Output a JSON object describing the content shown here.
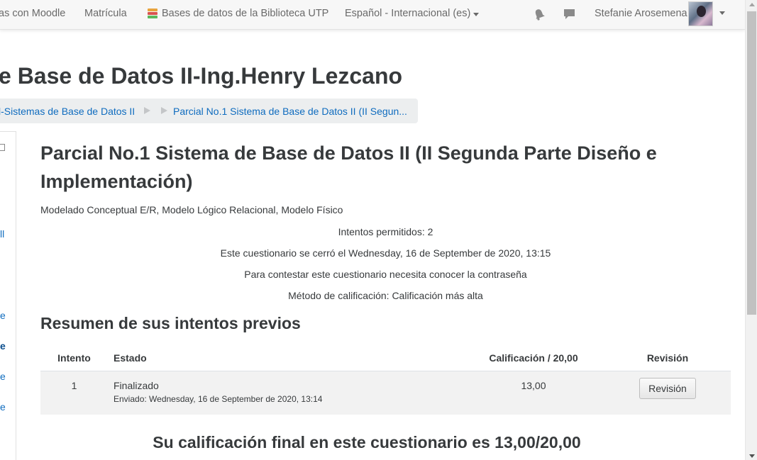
{
  "navbar": {
    "links": [
      "as con Moodle",
      "Matrícula",
      "Bases de datos de la Biblioteca UTP"
    ],
    "language": "Español - Internacional (es)",
    "user_name": "Stefanie Arosemena",
    "icons": [
      "database-icon",
      "bell-icon",
      "chat-icon",
      "avatar"
    ]
  },
  "header": {
    "course_title": "e Base de Datos II-Ing.Henry Lezcano",
    "breadcrumb": [
      "l-Sistemas de Base de Datos II",
      "Parcial No.1 Sistema de Base de Datos II (II Segun..."
    ]
  },
  "left_nav": {
    "fragments": [
      "ll",
      "e",
      "e",
      "e",
      "e"
    ]
  },
  "quiz": {
    "title": "Parcial No.1 Sistema de Base de Datos II (II Segunda Parte Diseño e Implementación)",
    "intro": "Modelado Conceptual E/R, Modelo Lógico Relacional, Modelo Físico",
    "info": [
      "Intentos permitidos: 2",
      "Este cuestionario se cerró el Wednesday, 16 de September de 2020, 13:15",
      "Para contestar este cuestionario necesita conocer la contraseña",
      "Método de calificación: Calificación más alta"
    ],
    "summary_heading": "Resumen de sus intentos previos",
    "table": {
      "headers": [
        "Intento",
        "Estado",
        "Calificación / 20,00",
        "Revisión"
      ],
      "rows": [
        {
          "attempt": "1",
          "state": "Finalizado",
          "submitted": "Enviado: Wednesday, 16 de September de 2020, 13:14",
          "grade": "13,00",
          "review_label": "Revisión"
        }
      ]
    },
    "final_grade": "Su calificación final en este cuestionario es 13,00/20,00"
  }
}
